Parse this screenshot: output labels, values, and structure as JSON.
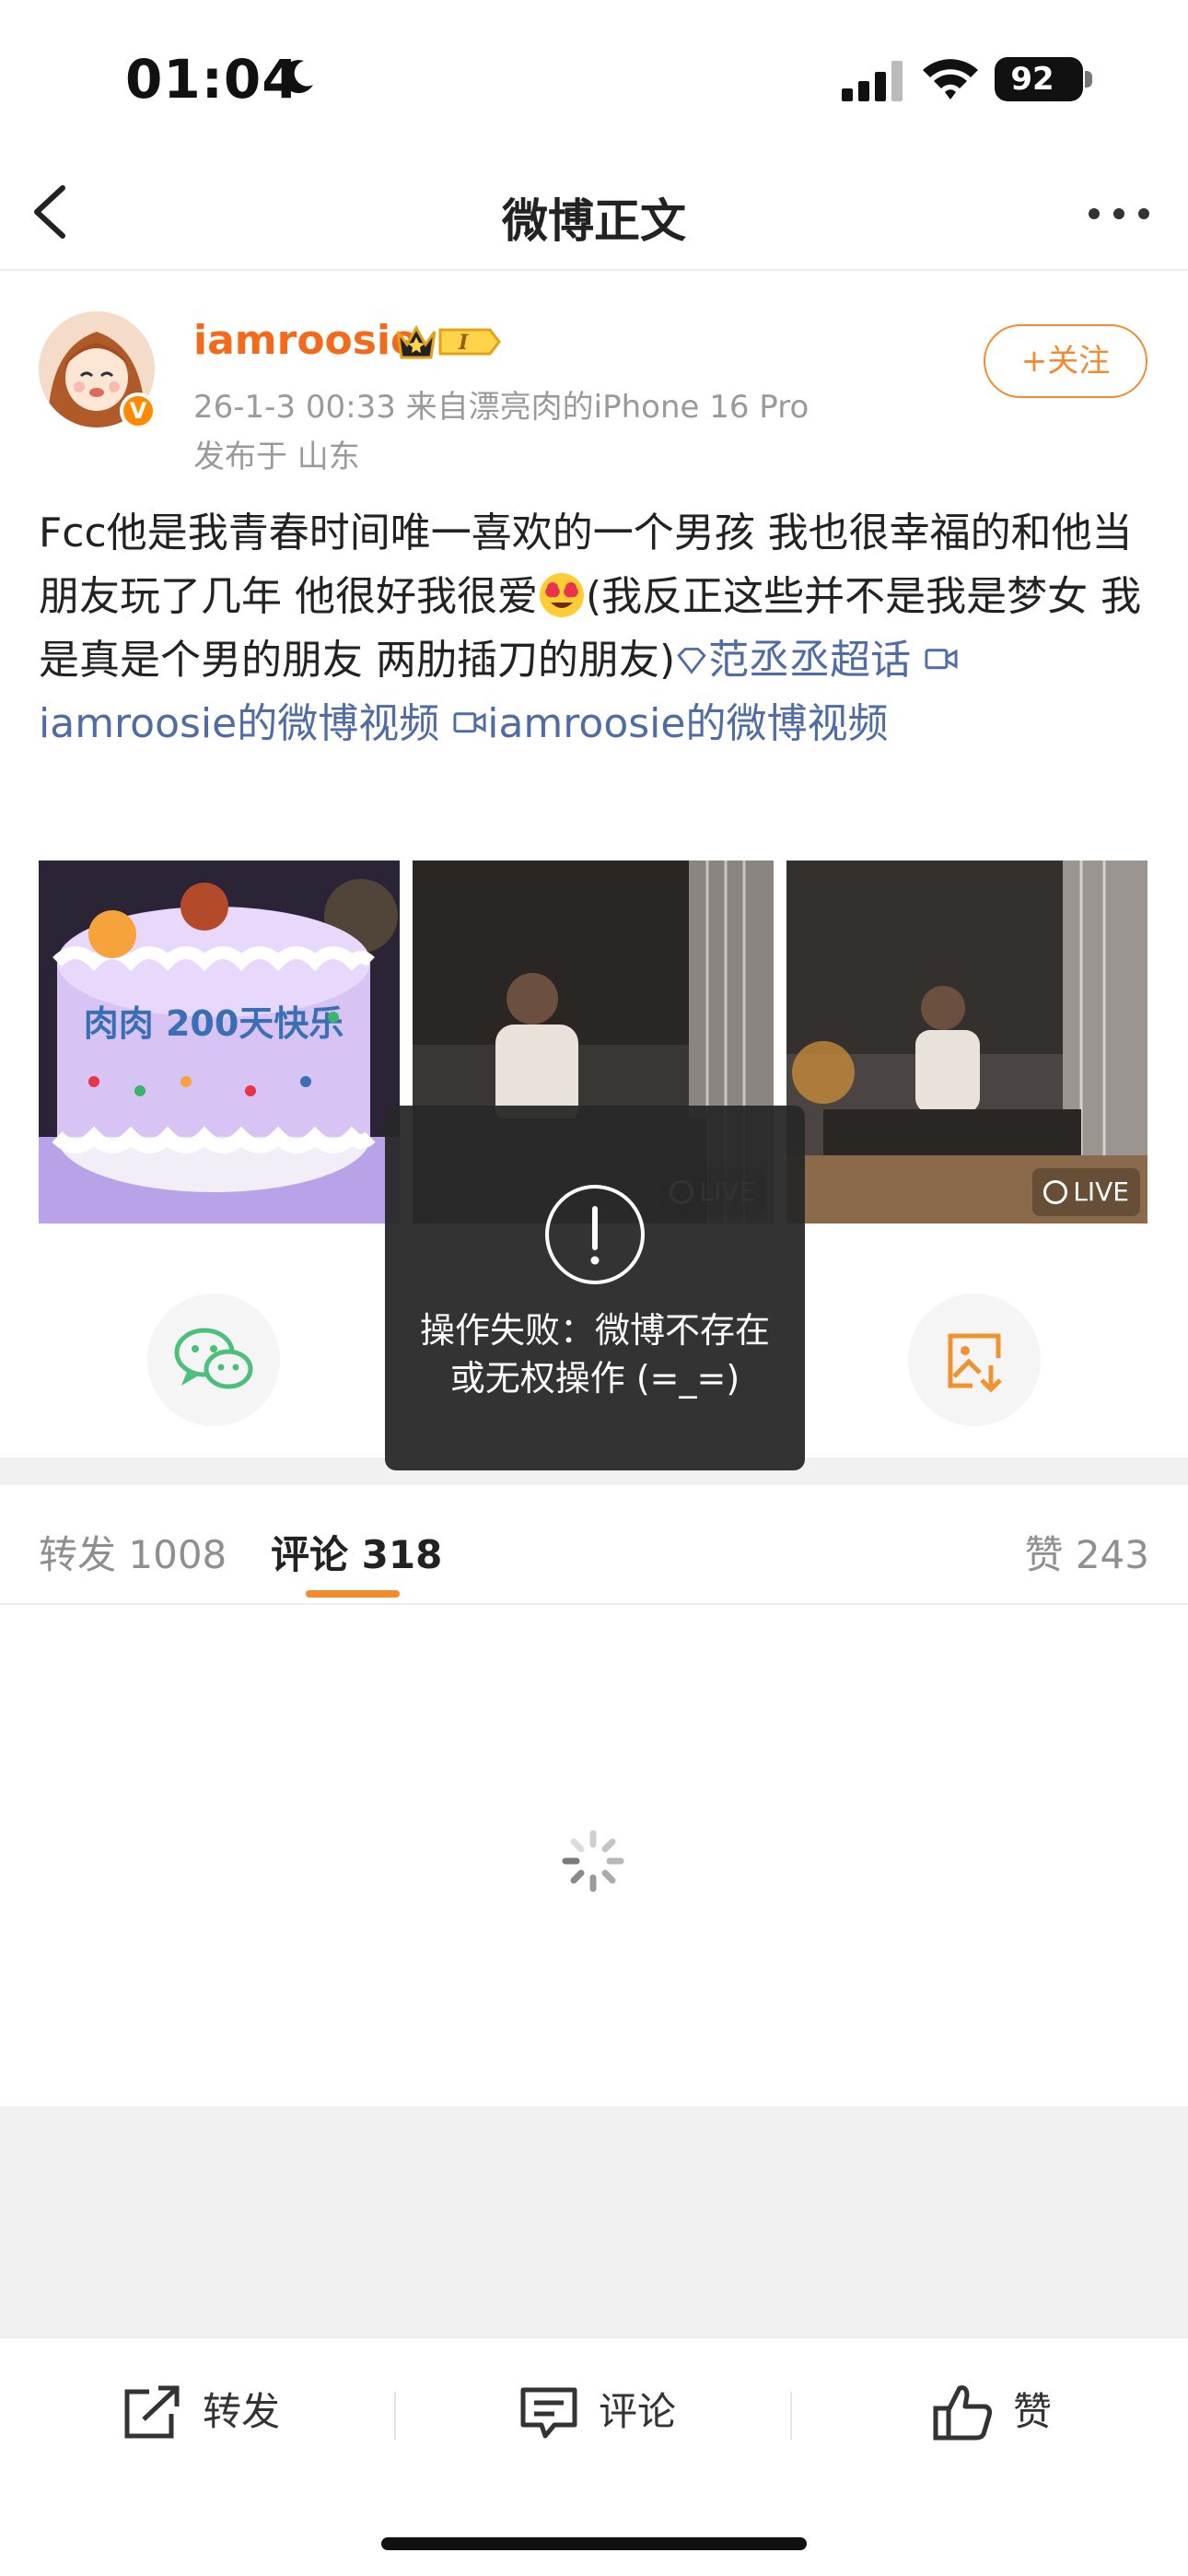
{
  "status_bar": {
    "time": "01:04",
    "battery": "92"
  },
  "nav": {
    "title": "微博正文"
  },
  "post": {
    "username": "iamroosie",
    "level_badge": "I",
    "meta": "26-1-3 00:33  来自漂亮肉的iPhone 16 Pro",
    "location": "发布于 山东",
    "follow_label": "+关注",
    "text_part1": "Fcc他是我青春时间唯一喜欢的一个男孩 我也很幸福的和他当朋友玩了几年  他很好我很爱",
    "text_part2": "(我反正这些并不是我是梦女 我是真是个男的朋友 两肋插刀的朋友)",
    "topic1": "范丞丞超话",
    "video_link1": "iamroosie的微博视频",
    "video_link2": "iamroosie的微博视频",
    "cake_text": "肉肉 200天快乐",
    "live_label": "LIVE"
  },
  "toast": {
    "message": "操作失败：微博不存在或无权操作 (=_=)"
  },
  "tabs": {
    "repost_label": "转发",
    "repost_count": "1008",
    "comment_label": "评论",
    "comment_count": "318",
    "like_label": "赞",
    "like_count": "243"
  },
  "toolbar": {
    "repost": "转发",
    "comment": "评论",
    "like": "赞"
  },
  "colors": {
    "accent": "#f28a2e",
    "username": "#f26b1d",
    "link": "#506ca4",
    "toast_bg": "#282828"
  },
  "icons": [
    "back-icon",
    "more-icon",
    "wechat-icon",
    "save-image-icon",
    "spinner-icon",
    "repost-icon",
    "comment-icon",
    "like-icon"
  ]
}
